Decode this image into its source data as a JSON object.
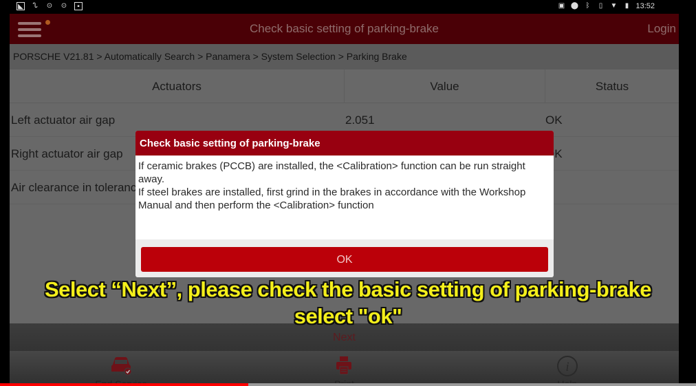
{
  "statusbar": {
    "time": "13:52",
    "left_icons": [
      "screenshot-icon",
      "stethoscope-icon",
      "focus-icon",
      "focus-icon",
      "image-icon"
    ],
    "right_icons": [
      "cast-icon",
      "location-icon",
      "bluetooth-icon",
      "vibrate-icon",
      "wifi-icon",
      "battery-icon"
    ]
  },
  "header": {
    "title": "Check basic setting of parking-brake",
    "login_label": "Login"
  },
  "breadcrumb": "PORSCHE V21.81 > Automatically Search > Panamera > System Selection > Parking Brake",
  "table": {
    "columns": [
      "Actuators",
      "Value",
      "Status"
    ],
    "rows": [
      {
        "actuator": "Left actuator air gap",
        "value": "2.051",
        "status": "OK"
      },
      {
        "actuator": "Right actuator air gap",
        "value": "",
        "status": "OK"
      },
      {
        "actuator": "Air clearance in tolerance",
        "value": "",
        "status": ""
      }
    ]
  },
  "dialog": {
    "title": "Check basic setting of parking-brake",
    "line1": "If ceramic brakes (PCCB) are installed, the <Calibration> function  can be run straight away.",
    "line2": "If steel brakes are installed, first grind in the brakes in accordance with the Workshop Manual and then perform the <Calibration> function",
    "ok_label": "OK"
  },
  "caption": {
    "line1": "Select “Next”, please check the basic setting of parking-brake",
    "line2": "select \"ok\""
  },
  "next_label": "Next",
  "toolbar": [
    {
      "label": "End Service",
      "icon": "car-check-icon"
    },
    {
      "label": "Print",
      "icon": "printer-icon"
    },
    {
      "label": "Help",
      "icon": "info-icon"
    }
  ],
  "video": {
    "progress_fraction": 0.357
  },
  "colors": {
    "header_bg": "#4a0006",
    "dialog_header": "#980010",
    "ok_button": "#bb0009",
    "caption": "#f4ef1b",
    "progress": "#ff0000"
  }
}
